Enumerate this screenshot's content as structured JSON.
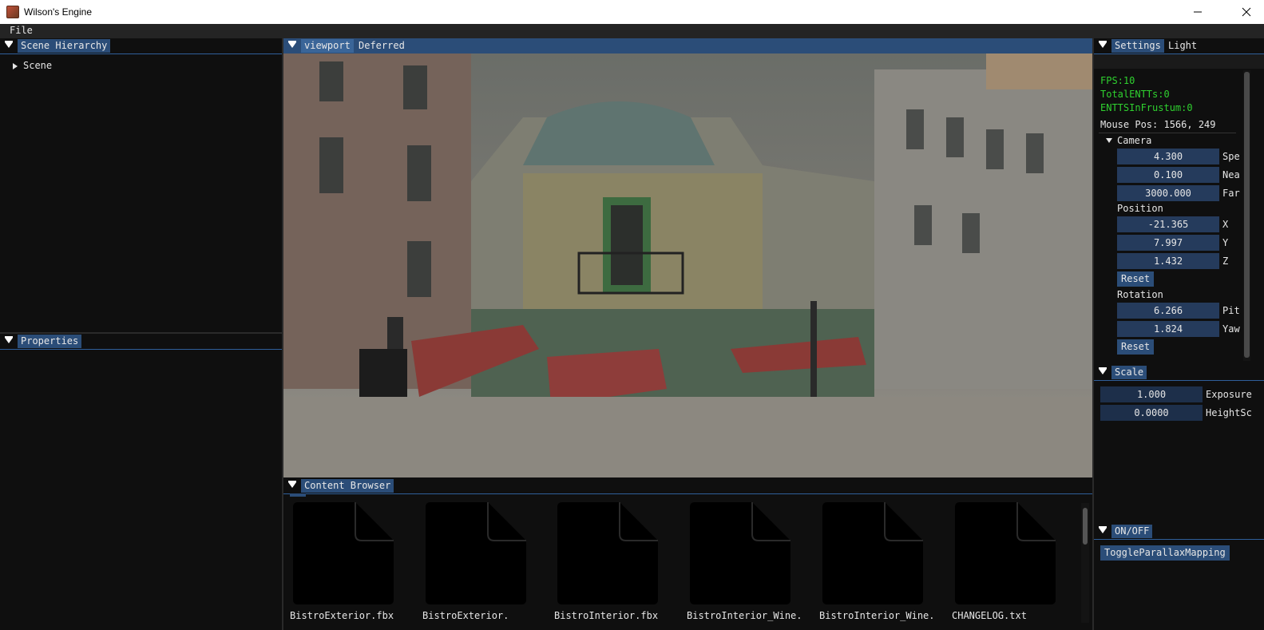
{
  "window": {
    "title": "Wilson's Engine"
  },
  "menu": {
    "file": "File"
  },
  "scene_hierarchy": {
    "tab": "Scene Hierarchy",
    "root_node": "Scene"
  },
  "properties": {
    "tab": "Properties"
  },
  "viewport": {
    "tabs": [
      "viewport",
      "Deferred"
    ]
  },
  "settings": {
    "tabs": [
      "Settings",
      "Light"
    ],
    "fps": "FPS:10",
    "total_entts": "TotalENTTs:0",
    "entts_in_frustum": "ENTTSInFrustum:0",
    "mouse_pos": "Mouse Pos: 1566, 249",
    "camera": {
      "header": "Camera",
      "speed": {
        "value": "4.300",
        "label": "Spe"
      },
      "near": {
        "value": "0.100",
        "label": "Nea"
      },
      "far": {
        "value": "3000.000",
        "label": "Far"
      },
      "position_header": "Position",
      "x": {
        "value": "-21.365",
        "label": "X"
      },
      "y": {
        "value": "7.997",
        "label": "Y"
      },
      "z": {
        "value": "1.432",
        "label": "Z"
      },
      "reset_position": "Reset",
      "rotation_header": "Rotation",
      "pitch": {
        "value": "6.266",
        "label": "Pit"
      },
      "yaw": {
        "value": "1.824",
        "label": "Yaw"
      },
      "reset_rotation": "Reset"
    }
  },
  "scale": {
    "tab": "Scale",
    "exposure": {
      "value": "1.000",
      "label": "Exposure"
    },
    "height_scale": {
      "value": "0.0000",
      "label": "HeightSc"
    }
  },
  "onoff": {
    "tab": "ON/OFF",
    "toggle_parallax": "ToggleParallaxMapping"
  },
  "content_browser": {
    "tab": "Content Browser",
    "files": [
      {
        "name": "BistroExterior.fbx"
      },
      {
        "name": "BistroExterior."
      },
      {
        "name": "BistroInterior.fbx"
      },
      {
        "name": "BistroInterior_Wine."
      },
      {
        "name": "BistroInterior_Wine."
      },
      {
        "name": "CHANGELOG.txt"
      }
    ]
  },
  "colors": {
    "tab_active": "#2b4d78",
    "field": "#253b5c",
    "stats_green": "#2fd12f",
    "panel_bg": "#0f0f0f"
  }
}
